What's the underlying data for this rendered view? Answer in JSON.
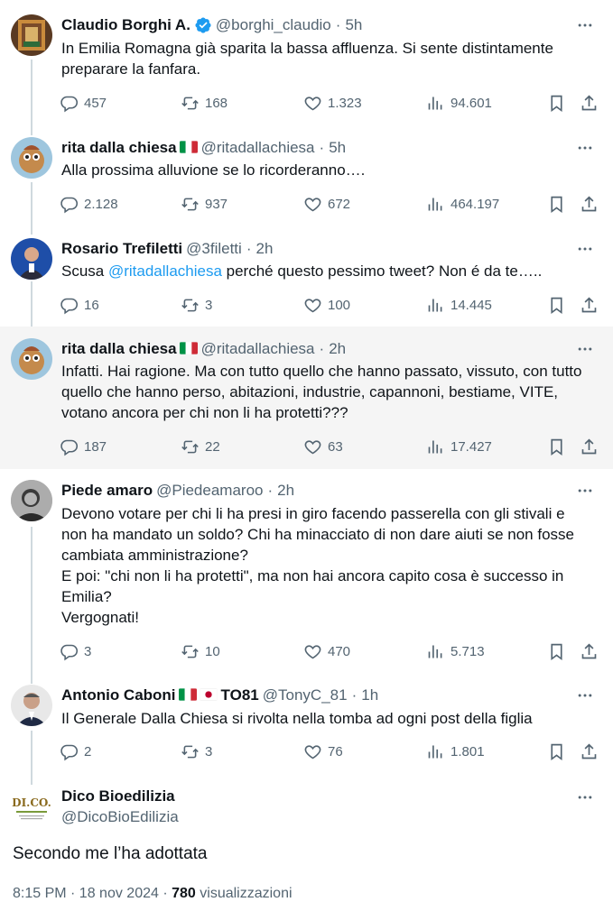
{
  "tweets": [
    {
      "name": "Claudio Borghi A.",
      "verified": true,
      "handle": "@borghi_claudio",
      "time": "5h",
      "text": "In Emilia Romagna già sparita la bassa affluenza. Si sente distintamente preparare la fanfara.",
      "replies": "457",
      "retweets": "168",
      "likes": "1.323",
      "views": "94.601"
    },
    {
      "name": "rita dalla chiesa",
      "handle": "@ritadallachiesa",
      "time": "5h",
      "text": "Alla prossima alluvione se lo ricorderanno….",
      "replies": "2.128",
      "retweets": "937",
      "likes": "672",
      "views": "464.197"
    },
    {
      "name": "Rosario Trefiletti",
      "handle": "@3filetti",
      "time": "2h",
      "text_before": "Scusa ",
      "mention": "@ritadallachiesa",
      "text_after": " perché questo pessimo tweet? Non é da te…..",
      "replies": "16",
      "retweets": "3",
      "likes": "100",
      "views": "14.445"
    },
    {
      "name": "rita dalla chiesa",
      "handle": "@ritadallachiesa",
      "time": "2h",
      "text": "Infatti. Hai ragione. Ma con tutto quello che hanno passato, vissuto, con tutto quello che hanno perso, abitazioni, industrie, capannoni, bestiame, VITE, votano ancora per chi non li ha protetti???",
      "replies": "187",
      "retweets": "22",
      "likes": "63",
      "views": "17.427"
    },
    {
      "name": "Piede amaro",
      "handle": "@Piedeamaroo",
      "time": "2h",
      "text_lines": [
        "Devono votare per chi li ha presi in giro facendo passerella con gli stivali e non ha mandato un soldo? Chi ha minacciato di non dare aiuti se non fosse cambiata amministrazione?",
        "E poi: \"chi non li ha protetti\", ma non hai ancora capito cosa è successo in Emilia?",
        "Vergognati!"
      ],
      "replies": "3",
      "retweets": "10",
      "likes": "470",
      "views": "5.713"
    },
    {
      "name_before": "Antonio Caboni",
      "name_after": "TO81",
      "handle": "@TonyC_81",
      "time": "1h",
      "text": "Il Generale Dalla Chiesa si rivolta nella tomba ad ogni post della figlia",
      "replies": "2",
      "retweets": "3",
      "likes": "76",
      "views": "1.801"
    }
  ],
  "main": {
    "name": "Dico Bioedilizia",
    "handle": "@DicoBioEdilizia",
    "avatar_logo": "DI.CO.",
    "text": "Secondo me l’ha adottata",
    "meta_time": "8:15 PM · 18 nov 2024 · ",
    "meta_views": "780",
    "meta_views_label": " visualizzazioni"
  },
  "dot": "·",
  "icons": {
    "reply": "reply-icon",
    "retweet": "retweet-icon",
    "like": "heart-icon",
    "views": "views-icon",
    "bookmark": "bookmark-icon",
    "share": "share-icon",
    "more": "more-icon",
    "verified": "verified-badge-icon"
  },
  "colors": {
    "text": "#0f1419",
    "secondary": "#536471",
    "link": "#1d9bf0",
    "verified": "#1d9bf0",
    "thread_line": "#cfd9de",
    "highlight_bg": "#f5f5f5"
  }
}
